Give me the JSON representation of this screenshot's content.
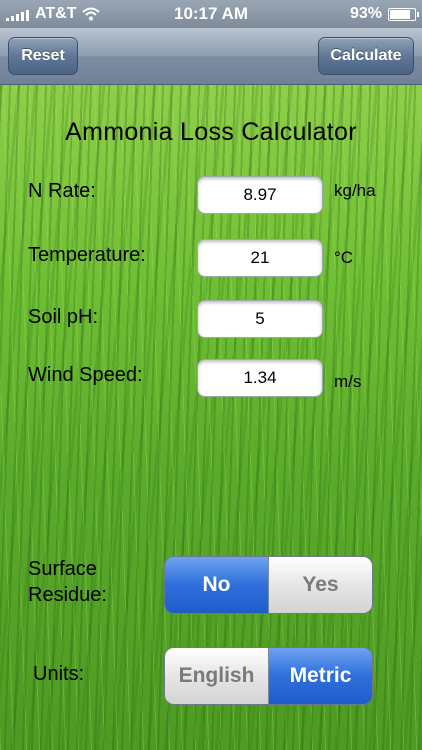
{
  "status_bar": {
    "carrier": "AT&T",
    "time": "10:17 AM",
    "battery": "93%"
  },
  "nav": {
    "reset_label": "Reset",
    "calculate_label": "Calculate"
  },
  "title": "Ammonia Loss Calculator",
  "fields": {
    "n_rate": {
      "label": "N Rate:",
      "value": "8.97",
      "unit": "kg/ha"
    },
    "temperature": {
      "label": "Temperature:",
      "value": "21",
      "unit": "°C"
    },
    "soil_ph": {
      "label": "Soil pH:",
      "value": "5"
    },
    "wind_speed": {
      "label": "Wind Speed:",
      "value": "1.34",
      "unit": "m/s"
    }
  },
  "surface_residue": {
    "label_line1": "Surface",
    "label_line2": "Residue:",
    "options": [
      "No",
      "Yes"
    ],
    "selected": "No"
  },
  "units": {
    "label": "Units:",
    "options": [
      "English",
      "Metric"
    ],
    "selected": "Metric"
  }
}
